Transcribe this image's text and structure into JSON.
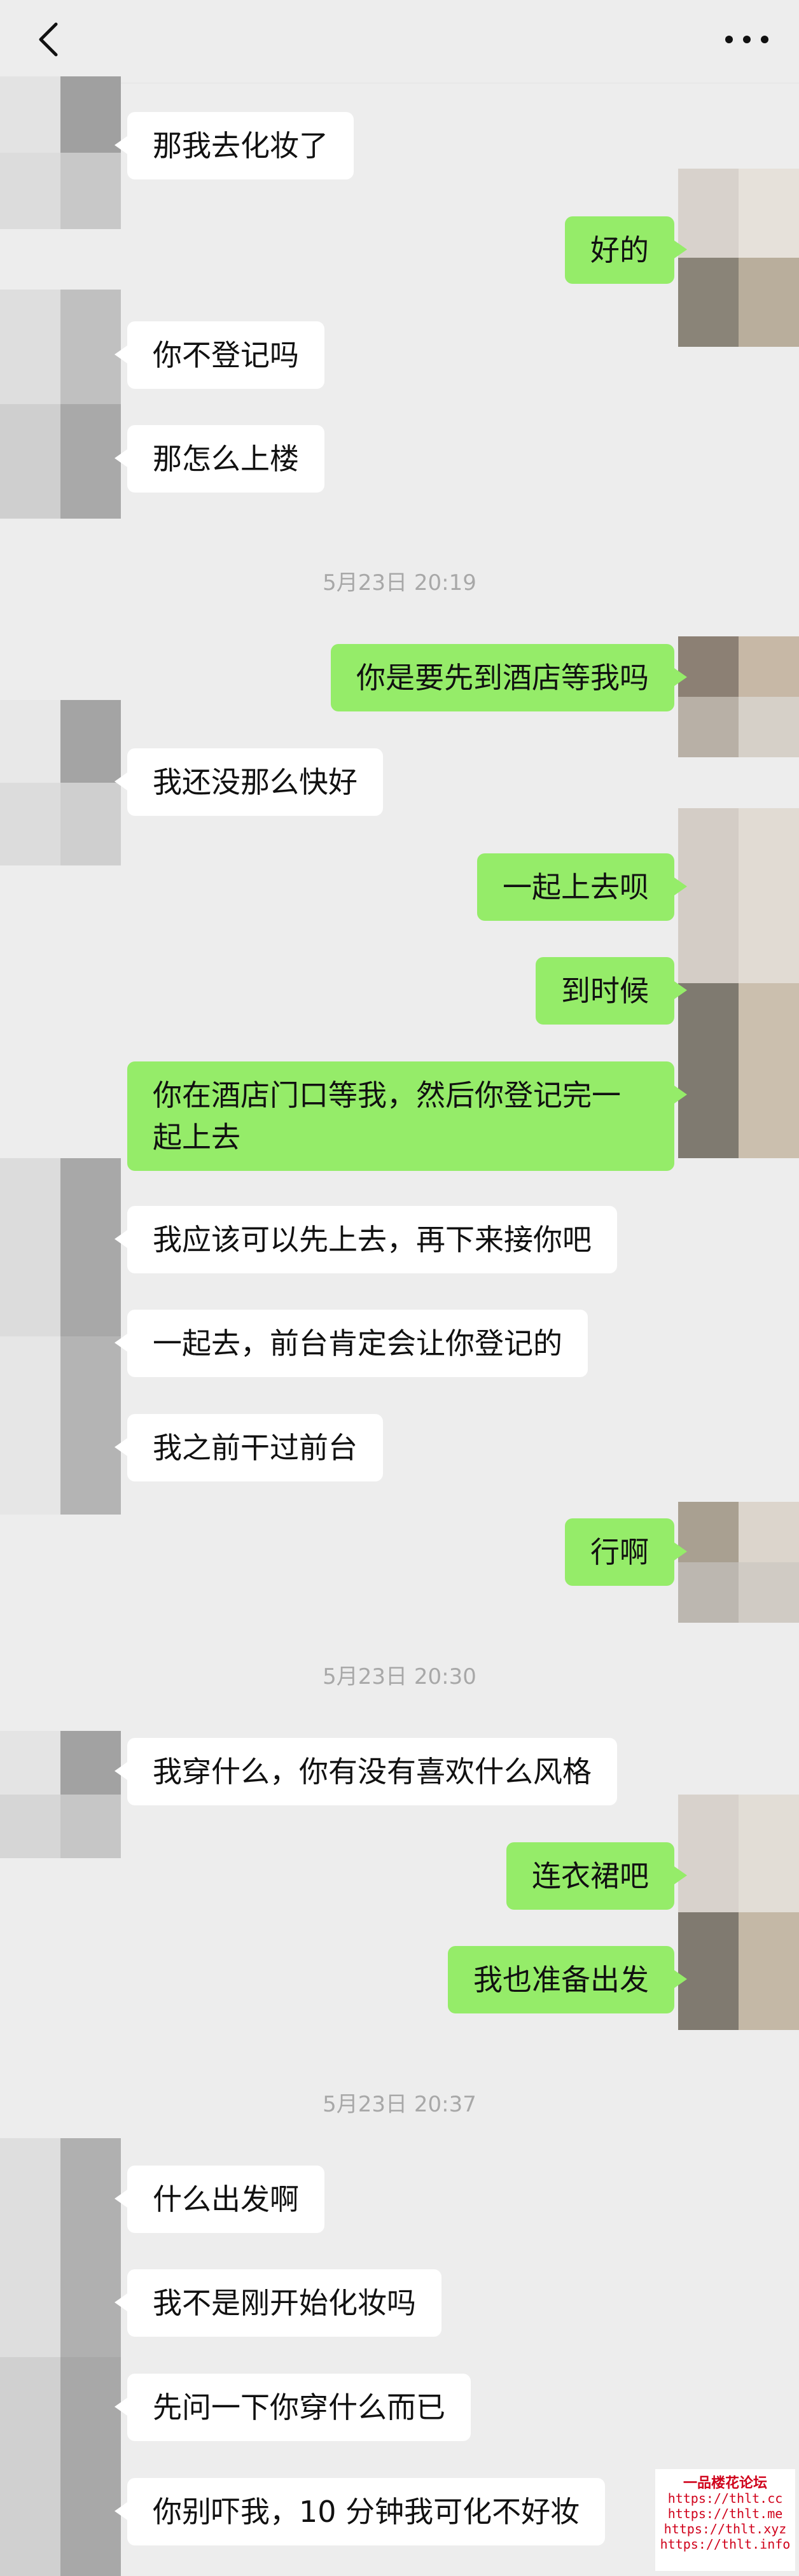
{
  "header": {
    "back_icon": "chevron-left-icon",
    "more_icon": "ellipsis-icon"
  },
  "colors": {
    "background": "#ededed",
    "sent_bubble": "#95ec69",
    "received_bubble": "#ffffff",
    "timestamp": "#a8a8a8"
  },
  "messages": [
    {
      "side": "recv",
      "text": "那我去化妆了"
    },
    {
      "side": "sent",
      "text": "好的"
    },
    {
      "side": "recv",
      "text": "你不登记吗"
    },
    {
      "side": "recv",
      "text": "那怎么上楼"
    },
    {
      "side": "time",
      "text": "5月23日 20:19"
    },
    {
      "side": "sent",
      "text": "你是要先到酒店等我吗"
    },
    {
      "side": "recv",
      "text": "我还没那么快好"
    },
    {
      "side": "sent",
      "text": "一起上去呗"
    },
    {
      "side": "sent",
      "text": "到时候"
    },
    {
      "side": "sent",
      "text": "你在酒店门口等我，然后你登记完一起上去"
    },
    {
      "side": "recv",
      "text": "我应该可以先上去，再下来接你吧"
    },
    {
      "side": "recv",
      "text": "一起去，前台肯定会让你登记的"
    },
    {
      "side": "recv",
      "text": "我之前干过前台"
    },
    {
      "side": "sent",
      "text": "行啊"
    },
    {
      "side": "time",
      "text": "5月23日 20:30"
    },
    {
      "side": "recv",
      "text": "我穿什么，你有没有喜欢什么风格"
    },
    {
      "side": "sent",
      "text": "连衣裙吧"
    },
    {
      "side": "sent",
      "text": "我也准备出发"
    },
    {
      "side": "time",
      "text": "5月23日 20:37"
    },
    {
      "side": "recv",
      "text": "什么出发啊"
    },
    {
      "side": "recv",
      "text": "我不是刚开始化妆吗"
    },
    {
      "side": "recv",
      "text": "先问一下你穿什么而已"
    },
    {
      "side": "recv",
      "text": "你别吓我，10 分钟我可化不好妆"
    }
  ],
  "watermark": {
    "title": "一品楼花论坛",
    "lines": [
      "https://thlt.cc",
      "https://thlt.me",
      "https://thlt.xyz",
      "https://thlt.info"
    ]
  }
}
